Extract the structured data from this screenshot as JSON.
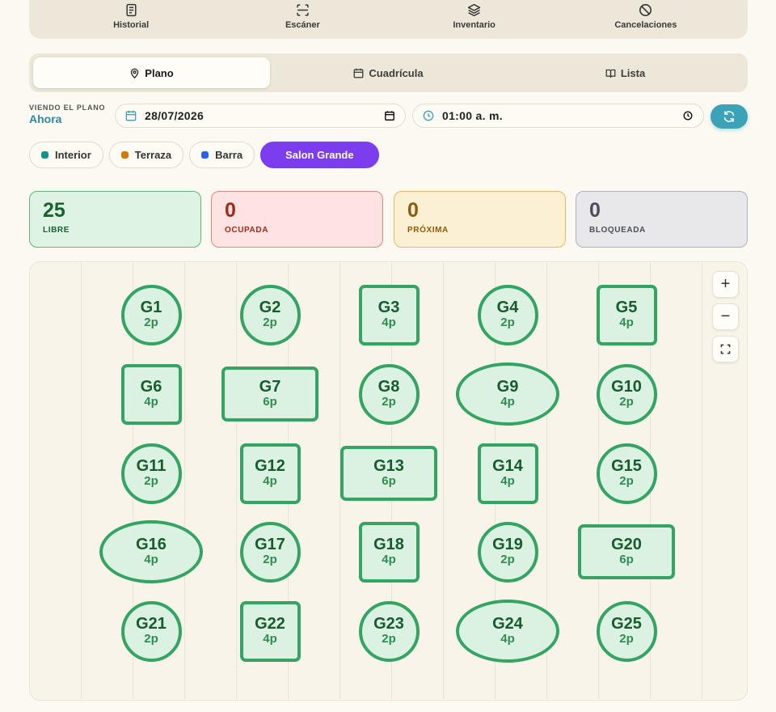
{
  "topnav": [
    {
      "label": "Historial",
      "icon": "document-icon"
    },
    {
      "label": "Escáner",
      "icon": "scan-icon"
    },
    {
      "label": "Inventario",
      "icon": "layers-icon"
    },
    {
      "label": "Cancelaciones",
      "icon": "ban-icon"
    }
  ],
  "view_tabs": [
    {
      "label": "Plano",
      "icon": "map-pin-icon",
      "active": true
    },
    {
      "label": "Cuadrícula",
      "icon": "calendar-icon",
      "active": false
    },
    {
      "label": "Lista",
      "icon": "book-icon",
      "active": false
    }
  ],
  "viewing": {
    "label": "VIENDO EL PLANO",
    "value": "Ahora"
  },
  "date": {
    "value": "28/07/2026"
  },
  "time": {
    "value": "01:00 a. m."
  },
  "zones": [
    {
      "label": "Interior",
      "color": "#0f9488",
      "active": false
    },
    {
      "label": "Terraza",
      "color": "#d97706",
      "active": false
    },
    {
      "label": "Barra",
      "color": "#2563eb",
      "active": false
    },
    {
      "label": "Salon Grande",
      "color": "#7b3ded",
      "active": true
    }
  ],
  "stats": {
    "libre": {
      "count": "25",
      "label": "LIBRE"
    },
    "ocupada": {
      "count": "0",
      "label": "OCUPADA"
    },
    "proxima": {
      "count": "0",
      "label": "PRÓXIMA"
    },
    "bloqueada": {
      "count": "0",
      "label": "BLOQUEADA"
    }
  },
  "tables": [
    {
      "name": "G1",
      "cap": "2p",
      "shape": "round"
    },
    {
      "name": "G2",
      "cap": "2p",
      "shape": "round"
    },
    {
      "name": "G3",
      "cap": "4p",
      "shape": "square"
    },
    {
      "name": "G4",
      "cap": "2p",
      "shape": "round"
    },
    {
      "name": "G5",
      "cap": "4p",
      "shape": "square"
    },
    {
      "name": "G6",
      "cap": "4p",
      "shape": "square"
    },
    {
      "name": "G7",
      "cap": "6p",
      "shape": "rect"
    },
    {
      "name": "G8",
      "cap": "2p",
      "shape": "round"
    },
    {
      "name": "G9",
      "cap": "4p",
      "shape": "oval"
    },
    {
      "name": "G10",
      "cap": "2p",
      "shape": "round"
    },
    {
      "name": "G11",
      "cap": "2p",
      "shape": "round"
    },
    {
      "name": "G12",
      "cap": "4p",
      "shape": "square"
    },
    {
      "name": "G13",
      "cap": "6p",
      "shape": "rect"
    },
    {
      "name": "G14",
      "cap": "4p",
      "shape": "square"
    },
    {
      "name": "G15",
      "cap": "2p",
      "shape": "round"
    },
    {
      "name": "G16",
      "cap": "4p",
      "shape": "oval"
    },
    {
      "name": "G17",
      "cap": "2p",
      "shape": "round"
    },
    {
      "name": "G18",
      "cap": "4p",
      "shape": "square"
    },
    {
      "name": "G19",
      "cap": "2p",
      "shape": "round"
    },
    {
      "name": "G20",
      "cap": "6p",
      "shape": "rect"
    },
    {
      "name": "G21",
      "cap": "2p",
      "shape": "round"
    },
    {
      "name": "G22",
      "cap": "4p",
      "shape": "square"
    },
    {
      "name": "G23",
      "cap": "2p",
      "shape": "round"
    },
    {
      "name": "G24",
      "cap": "4p",
      "shape": "oval"
    },
    {
      "name": "G25",
      "cap": "2p",
      "shape": "round"
    }
  ],
  "zoom": {
    "in": "+",
    "out": "−"
  }
}
